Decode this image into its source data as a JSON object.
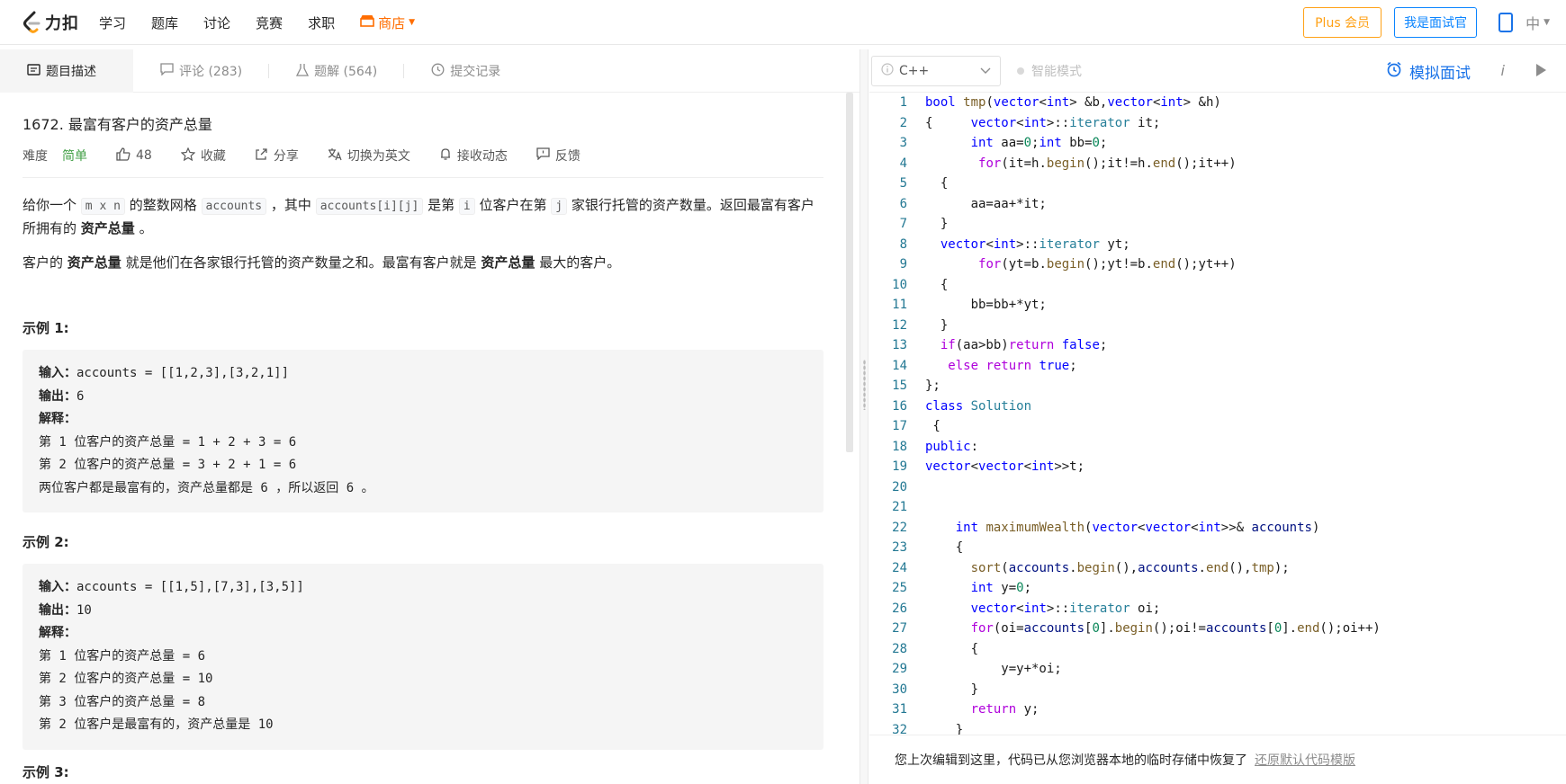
{
  "nav": {
    "brand": "力扣",
    "links": [
      "学习",
      "题库",
      "讨论",
      "竞赛",
      "求职"
    ],
    "store": "商店",
    "plus": "Plus 会员",
    "interviewer": "我是面试官",
    "lang": "中"
  },
  "left_tabs": [
    {
      "label": "题目描述"
    },
    {
      "label": "评论 (283)"
    },
    {
      "label": "题解 (564)"
    },
    {
      "label": "提交记录"
    }
  ],
  "problem": {
    "title": "1672. 最富有客户的资产总量",
    "difficulty_label": "难度",
    "difficulty": "简单",
    "likes": "48",
    "favorite": "收藏",
    "share": "分享",
    "switch_lang": "切换为英文",
    "follow": "接收动态",
    "feedback": "反馈",
    "desc1_a": "给你一个",
    "desc1_code1": "m x n",
    "desc1_b": "的整数网格",
    "desc1_code2": "accounts",
    "desc1_c": "，其中",
    "desc1_code3": "accounts[i][j]",
    "desc1_d": "是第",
    "desc1_code4": "i",
    "desc1_e": "位客户在第",
    "desc1_code5": "j",
    "desc1_f": "家银行托管的资产数量。返回最富有客户所拥有的",
    "desc1_bold": "资产总量",
    "desc1_g": "。",
    "desc2_a": "客户的",
    "desc2_bold1": "资产总量",
    "desc2_b": "就是他们在各家银行托管的资产数量之和。最富有客户就是",
    "desc2_bold2": "资产总量",
    "desc2_c": "最大的客户。",
    "examples": [
      {
        "title": "示例 1:",
        "input_label": "输入：",
        "input": "accounts = [[1,2,3],[3,2,1]]",
        "output_label": "输出：",
        "output": "6",
        "explain_label": "解释：",
        "lines": [
          "第 1 位客户的资产总量 = 1 + 2 + 3 = 6",
          "第 2 位客户的资产总量 = 3 + 2 + 1 = 6",
          "两位客户都是最富有的，资产总量都是 6 ，所以返回 6 。"
        ]
      },
      {
        "title": "示例 2:",
        "input_label": "输入：",
        "input": "accounts = [[1,5],[7,3],[3,5]]",
        "output_label": "输出：",
        "output": "10",
        "explain_label": "解释：",
        "lines": [
          "第 1 位客户的资产总量 = 6",
          "第 2 位客户的资产总量 = 10",
          "第 3 位客户的资产总量 = 8",
          "第 2 位客户是最富有的，资产总量是 10"
        ]
      }
    ],
    "example3_title": "示例 3:"
  },
  "editor": {
    "language": "C++",
    "smart_mode": "智能模式",
    "mock_interview": "模拟面试",
    "info": "i",
    "restore_notice": "您上次编辑到这里，代码已从您浏览器本地的临时存储中恢复了",
    "restore_link": "还原默认代码模版",
    "colors": {
      "keyword": "#0000ff",
      "type": "#267f99",
      "control": "#af00db",
      "func": "#795e26",
      "number": "#098658",
      "lineno": "#237893"
    },
    "lines": [
      "bool tmp(vector<int> &b,vector<int> &h)",
      "{     vector<int>::iterator it;",
      "      int aa=0;int bb=0;",
      "       for(it=h.begin();it!=h.end();it++)",
      "  {",
      "      aa=aa+*it;",
      "  }",
      "  vector<int>::iterator yt;",
      "       for(yt=b.begin();yt!=b.end();yt++)",
      "  {",
      "      bb=bb+*yt;",
      "  }",
      "  if(aa>bb)return false;",
      "   else return true;",
      "};",
      "class Solution",
      " {",
      "public:",
      "vector<vector<int>>t;",
      "",
      "",
      "    int maximumWealth(vector<vector<int>>& accounts)",
      "    {",
      "      sort(accounts.begin(),accounts.end(),tmp);",
      "      int y=0;",
      "      vector<int>::iterator oi;",
      "      for(oi=accounts[0].begin();oi!=accounts[0].end();oi++)",
      "      {",
      "          y=y+*oi;",
      "      }",
      "      return y;",
      "    }"
    ]
  }
}
